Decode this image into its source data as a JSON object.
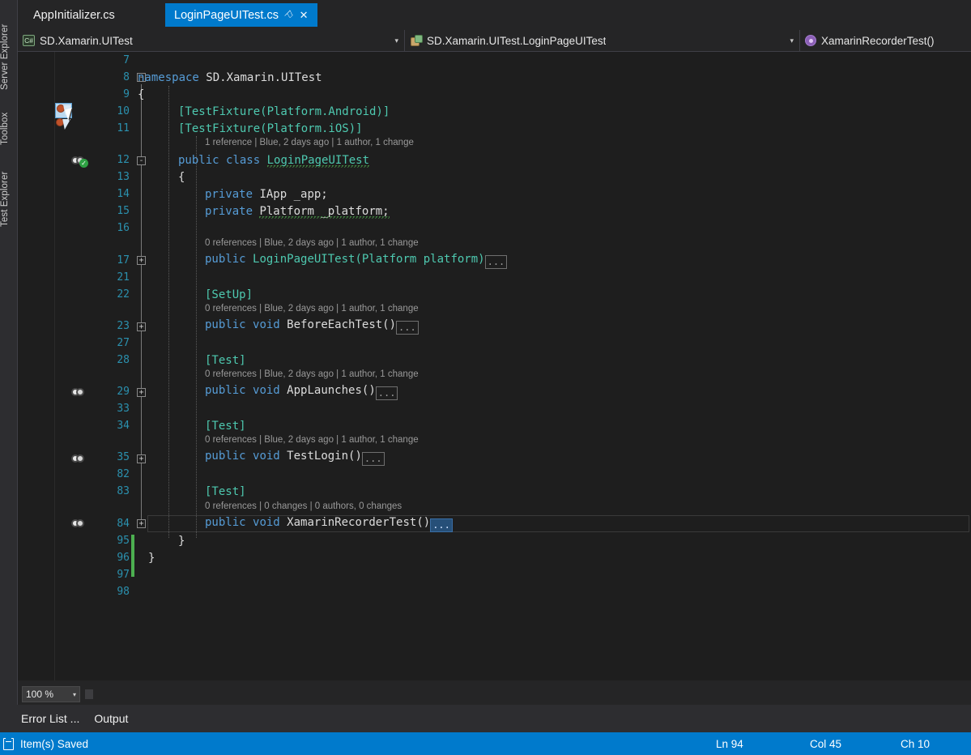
{
  "left_dock": {
    "tabs": [
      {
        "label": "Server Explorer"
      },
      {
        "label": "Toolbox"
      },
      {
        "label": "Test Explorer"
      }
    ]
  },
  "tabstrip": {
    "tabs": [
      {
        "label": "AppInitializer.cs",
        "active": false
      },
      {
        "label": "LoginPageUITest.cs",
        "active": true
      }
    ],
    "pin_glyph": "⚐",
    "close_glyph": "✕"
  },
  "navbar": {
    "project": "SD.Xamarin.UITest",
    "type": "SD.Xamarin.UITest.LoginPageUITest",
    "member": "XamarinRecorderTest()",
    "arrow": "▾"
  },
  "editor": {
    "ellipsis": "...",
    "lines": [
      {
        "num": "7",
        "code": "",
        "lens": null
      },
      {
        "num": "8",
        "code": "namespace SD.Xamarin.UITest",
        "lens": null
      },
      {
        "num": "9",
        "code": "{",
        "lens": null
      },
      {
        "num": "10",
        "code": "    [TestFixture(Platform.Android)]",
        "lens": null
      },
      {
        "num": "11",
        "code": "    [TestFixture(Platform.iOS)]",
        "lens": null
      },
      {
        "num": "12",
        "code": "    public class LoginPageUITest",
        "lens": "1 reference | Blue, 2 days ago | 1 author, 1 change"
      },
      {
        "num": "13",
        "code": "    {",
        "lens": null
      },
      {
        "num": "14",
        "code": "        private IApp _app;",
        "lens": null
      },
      {
        "num": "15",
        "code": "        private Platform _platform;",
        "lens": null
      },
      {
        "num": "16",
        "code": "",
        "lens": null
      },
      {
        "num": "17",
        "code": "        public LoginPageUITest(Platform platform)",
        "lens": "0 references | Blue, 2 days ago | 1 author, 1 change"
      },
      {
        "num": "21",
        "code": "",
        "lens": null
      },
      {
        "num": "22",
        "code": "        [SetUp]",
        "lens": null
      },
      {
        "num": "23",
        "code": "        public void BeforeEachTest()",
        "lens": "0 references | Blue, 2 days ago | 1 author, 1 change"
      },
      {
        "num": "27",
        "code": "",
        "lens": null
      },
      {
        "num": "28",
        "code": "        [Test]",
        "lens": null
      },
      {
        "num": "29",
        "code": "        public void AppLaunches()",
        "lens": "0 references | Blue, 2 days ago | 1 author, 1 change"
      },
      {
        "num": "33",
        "code": "",
        "lens": null
      },
      {
        "num": "34",
        "code": "        [Test]",
        "lens": null
      },
      {
        "num": "35",
        "code": "        public void TestLogin()",
        "lens": "0 references | Blue, 2 days ago | 1 author, 1 change"
      },
      {
        "num": "82",
        "code": "",
        "lens": null
      },
      {
        "num": "83",
        "code": "        [Test]",
        "lens": null
      },
      {
        "num": "84",
        "code": "        public void XamarinRecorderTest()",
        "lens": "0 references | 0 changes | 0 authors, 0 changes"
      },
      {
        "num": "95",
        "code": "    }",
        "lens": null
      },
      {
        "num": "96",
        "code": "}",
        "lens": null
      },
      {
        "num": "97",
        "code": "",
        "lens": null
      },
      {
        "num": "98",
        "code": "",
        "lens": null
      }
    ],
    "tokens": {
      "keyword_public": "public",
      "keyword_private": "private",
      "keyword_void": "void",
      "keyword_class": "class",
      "keyword_namespace": "namespace",
      "attr_testfixture_android": "[TestFixture(Platform.Android)]",
      "attr_testfixture_ios": "[TestFixture(Platform.iOS)]",
      "attr_setup": "[SetUp]",
      "attr_test": "[Test]",
      "ns_name": "SD.Xamarin.UITest",
      "class_name": "LoginPageUITest",
      "field_app": "IApp _app;",
      "field_platform": "Platform _platform;",
      "ctor": "LoginPageUITest(Platform platform)",
      "m_before": "BeforeEachTest()",
      "m_applaunches": "AppLaunches()",
      "m_testlogin": "TestLogin()",
      "m_recorder": "XamarinRecorderTest()",
      "brace_open": "{",
      "brace_close": "}",
      "fold_collapse": "-",
      "fold_expand": "+"
    }
  },
  "zoom_control": {
    "value": "100 %",
    "arrow": "▾"
  },
  "panel_tabs": [
    {
      "label": "Error List ..."
    },
    {
      "label": "Output"
    }
  ],
  "statusbar": {
    "message": "Item(s) Saved",
    "line": "Ln 94",
    "column": "Col 45",
    "character": "Ch 10"
  },
  "colors": {
    "accent": "#007acc",
    "editor_bg": "#1e1e1e",
    "chrome_bg": "#252526",
    "keyword": "#569cd6",
    "type": "#4ec9b0",
    "linenum": "#2b91af",
    "lens_text": "#999999",
    "change_bar": "#4caf50",
    "selection": "#264f78"
  }
}
